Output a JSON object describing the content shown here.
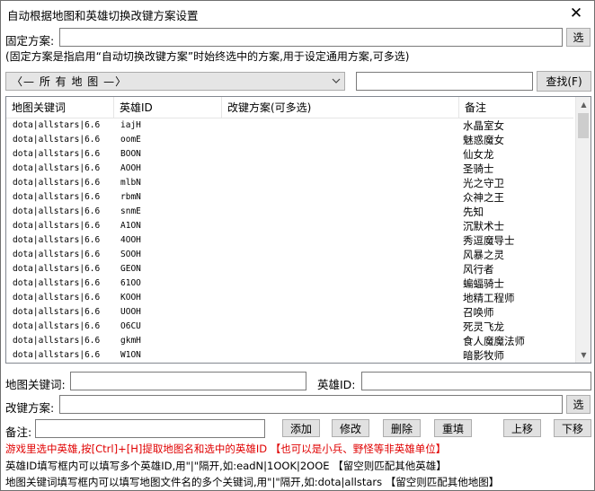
{
  "window": {
    "title": "自动根据地图和英雄切换改键方案设置",
    "close_glyph": "✕"
  },
  "fixed_scheme": {
    "label": "固定方案:",
    "value": "",
    "select_button": "选",
    "description": "(固定方案是指启用“自动切换改键方案”时始终选中的方案,用于设定通用方案,可多选)"
  },
  "map_filter": {
    "selected": "〈— 所 有 地 图 —〉",
    "search_value": "",
    "search_button": "查找(F)"
  },
  "table": {
    "columns": [
      "地图关键词",
      "英雄ID",
      "改键方案(可多选)",
      "备注"
    ],
    "rows": [
      {
        "map": "dota|allstars|6.6",
        "hero": "iajH",
        "scheme": "",
        "note": "水晶室女"
      },
      {
        "map": "dota|allstars|6.6",
        "hero": "oomE",
        "scheme": "",
        "note": "魅惑魔女"
      },
      {
        "map": "dota|allstars|6.6",
        "hero": "BOON",
        "scheme": "",
        "note": "仙女龙"
      },
      {
        "map": "dota|allstars|6.6",
        "hero": "AOOH",
        "scheme": "",
        "note": "圣骑士"
      },
      {
        "map": "dota|allstars|6.6",
        "hero": "mlbN",
        "scheme": "",
        "note": "光之守卫"
      },
      {
        "map": "dota|allstars|6.6",
        "hero": "rbmN",
        "scheme": "",
        "note": "众神之王"
      },
      {
        "map": "dota|allstars|6.6",
        "hero": "snmE",
        "scheme": "",
        "note": "先知"
      },
      {
        "map": "dota|allstars|6.6",
        "hero": "A1ON",
        "scheme": "",
        "note": "沉默术士"
      },
      {
        "map": "dota|allstars|6.6",
        "hero": "4OOH",
        "scheme": "",
        "note": "秀逗魔导士"
      },
      {
        "map": "dota|allstars|6.6",
        "hero": "SOOH",
        "scheme": "",
        "note": "风暴之灵"
      },
      {
        "map": "dota|allstars|6.6",
        "hero": "GEON",
        "scheme": "",
        "note": "风行者"
      },
      {
        "map": "dota|allstars|6.6",
        "hero": "61OO",
        "scheme": "",
        "note": "蝙蝠骑士"
      },
      {
        "map": "dota|allstars|6.6",
        "hero": "KOOH",
        "scheme": "",
        "note": "地精工程师"
      },
      {
        "map": "dota|allstars|6.6",
        "hero": "UOOH",
        "scheme": "",
        "note": "召唤师"
      },
      {
        "map": "dota|allstars|6.6",
        "hero": "O6CU",
        "scheme": "",
        "note": "死灵飞龙"
      },
      {
        "map": "dota|allstars|6.6",
        "hero": "gkmH",
        "scheme": "",
        "note": "食人魔魔法师"
      },
      {
        "map": "dota|allstars|6.6",
        "hero": "W1ON",
        "scheme": "",
        "note": "暗影牧师"
      }
    ]
  },
  "form": {
    "map_keyword_label": "地图关键词:",
    "map_keyword_value": "",
    "hero_id_label": "英雄ID:",
    "hero_id_value": "",
    "scheme_label": "改键方案:",
    "scheme_value": "",
    "scheme_select_button": "选",
    "note_label": "备注:",
    "note_value": ""
  },
  "actions": {
    "add": "添加",
    "modify": "修改",
    "delete": "删除",
    "reset": "重填",
    "move_up": "上移",
    "move_down": "下移"
  },
  "help": {
    "line1": "游戏里选中英雄,按[Ctrl]+[H]提取地图名和选中的英雄ID 【也可以是小兵、野怪等非英雄单位】",
    "line2": "英雄ID填写框内可以填写多个英雄ID,用\"|\"隔开,如:eadN|1OOK|2OOE 【留空则匹配其他英雄】",
    "line3": "地图关键词填写框内可以填写地图文件名的多个关键词,用\"|\"隔开,如:dota|allstars 【留空则匹配其他地图】"
  },
  "colors": {
    "help_red": "#e00000",
    "button_face": "#e1e1e1",
    "border": "#7a7a7a"
  }
}
